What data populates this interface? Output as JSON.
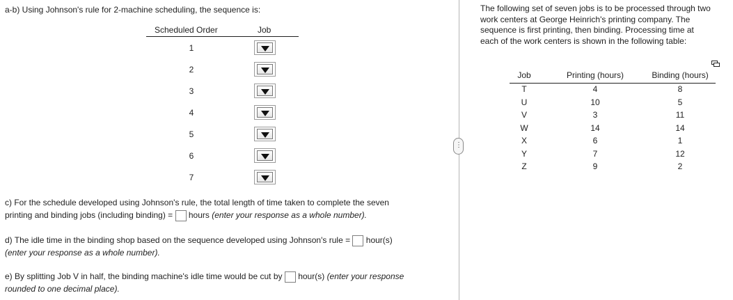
{
  "left": {
    "ab_prompt": "a-b) Using Johnson's rule for 2-machine scheduling, the sequence is:",
    "table": {
      "col_order": "Scheduled Order",
      "col_job": "Job",
      "orders": [
        "1",
        "2",
        "3",
        "4",
        "5",
        "6",
        "7"
      ]
    },
    "c": {
      "line1": "c) For the schedule developed using Johnson's rule, the total length of time taken to complete the seven",
      "line2_pre": "printing and binding jobs (including binding) =",
      "line2_post": "hours",
      "line2_hint": "(enter your response as a whole number)."
    },
    "d": {
      "line1_pre": "d) The idle time in the binding shop based on the sequence developed using Johnson's rule =",
      "line1_post": "hour(s)",
      "line2_hint": "(enter your response as a whole number)."
    },
    "e": {
      "line1_pre": "e) By splitting Job V in half, the binding machine's idle time would be cut by",
      "line1_post": "hour(s)",
      "line1_hint": "(enter your response",
      "line2_hint": "rounded to one decimal place)."
    }
  },
  "divider": {
    "handle_label": "⋮"
  },
  "right": {
    "intro": [
      "The following set of seven jobs is to be processed through two",
      "work centers at George Heinrich's printing company. The",
      "sequence is first printing, then binding. Processing time at",
      "each of the work centers is shown in the following table:"
    ],
    "table": {
      "headers": {
        "job": "Job",
        "printing": "Printing (hours)",
        "binding": "Binding (hours)"
      },
      "rows": [
        {
          "job": "T",
          "printing": "4",
          "binding": "8"
        },
        {
          "job": "U",
          "printing": "10",
          "binding": "5"
        },
        {
          "job": "V",
          "printing": "3",
          "binding": "11"
        },
        {
          "job": "W",
          "printing": "14",
          "binding": "14"
        },
        {
          "job": "X",
          "printing": "6",
          "binding": "1"
        },
        {
          "job": "Y",
          "printing": "7",
          "binding": "12"
        },
        {
          "job": "Z",
          "printing": "9",
          "binding": "2"
        }
      ]
    },
    "copy_icon": "copy-icon"
  }
}
